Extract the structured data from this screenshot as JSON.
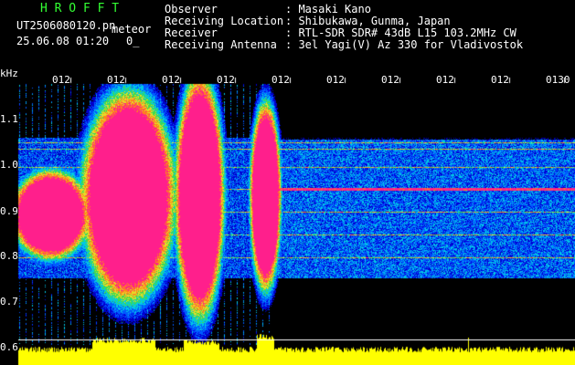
{
  "header": {
    "app_title": "H R O F F T",
    "filename": "UT2506080120.pn",
    "mode": "meteor",
    "datetime": "25.06.08 01:20",
    "counter": "0_",
    "info": [
      {
        "label": "Observer",
        "value": "Masaki Kano"
      },
      {
        "label": "Receiving Location",
        "value": "Shibukawa, Gunma, Japan"
      },
      {
        "label": "Receiver",
        "value": "RTL-SDR SDR# 43dB L15 103.2MHz CW"
      },
      {
        "label": "Receiving Antenna",
        "value": "3el Yagi(V) Az 330 for Vladivostok"
      }
    ]
  },
  "axis": {
    "unit": "kHz",
    "freq_ticks": [
      "1.1",
      "1.0",
      "0.9",
      "0.8",
      "0.7",
      "0.6"
    ],
    "time_ticks": [
      "012",
      "012",
      "012",
      "012",
      "012",
      "012",
      "012",
      "012",
      "012",
      "0130"
    ]
  },
  "colors": {
    "background": "#000000",
    "text": "#ffffff",
    "title": "#33ff33",
    "strong_echo": "#ff1f8c",
    "signal_trace": "#ffff00"
  }
}
